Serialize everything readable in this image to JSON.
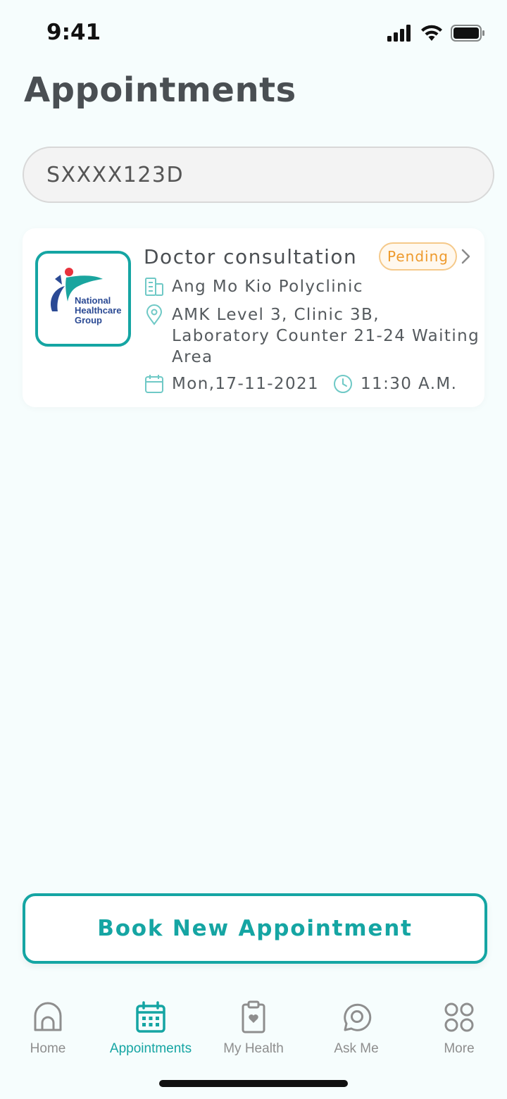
{
  "status_bar": {
    "time": "9:41"
  },
  "page": {
    "title": "Appointments"
  },
  "id_field": {
    "value": "SXXXX123D"
  },
  "appointment": {
    "title": "Doctor consultation",
    "status": "Pending",
    "clinic": "Ang Mo Kio Polyclinic",
    "location": "AMK Level 3, Clinic 3B, Laboratory Counter 21-24 Waiting Area",
    "date": "Mon,17-11-2021",
    "time": "11:30 A.M.",
    "logo_text": "National Healthcare Group"
  },
  "book_button": {
    "label": "Book New Appointment"
  },
  "nav": {
    "items": [
      {
        "label": "Home",
        "icon": "home-icon"
      },
      {
        "label": "Appointments",
        "icon": "calendar-icon"
      },
      {
        "label": "My Health",
        "icon": "clipboard-heart-icon"
      },
      {
        "label": "Ask Me",
        "icon": "chat-icon"
      },
      {
        "label": "More",
        "icon": "grid-icon"
      }
    ],
    "active_index": 1
  },
  "colors": {
    "accent": "#15a5a3",
    "pending": "#ee9a2c",
    "background": "#f6fdfd"
  }
}
